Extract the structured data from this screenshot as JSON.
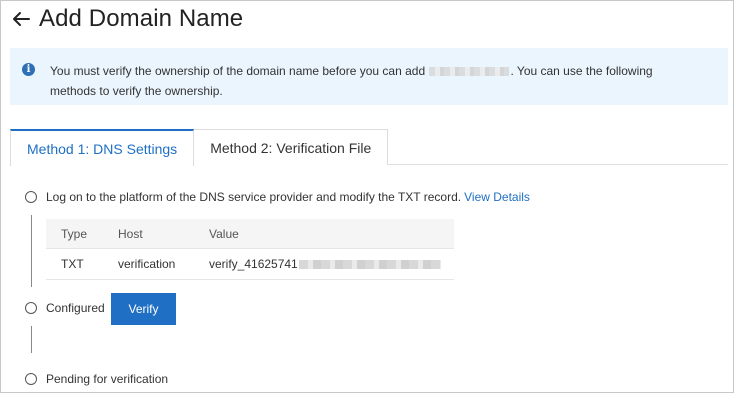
{
  "header": {
    "title": "Add Domain Name"
  },
  "notice": {
    "text_before": "You must verify the ownership of the domain name before you can add",
    "text_after": ". You can use the following",
    "text_line2": "methods to verify the ownership."
  },
  "tabs": [
    {
      "label": "Method 1: DNS Settings"
    },
    {
      "label": "Method 2: Verification File"
    }
  ],
  "steps": {
    "step1_text": "Log on to the platform of the DNS service provider and modify the TXT record.",
    "view_details": "View Details",
    "step2_text": "Configured",
    "verify_label": "Verify",
    "step3_text": "Pending for verification"
  },
  "record_table": {
    "columns": [
      "Type",
      "Host",
      "Value"
    ],
    "rows": [
      {
        "type": "TXT",
        "host": "verification",
        "value": "verify_41625741"
      }
    ]
  },
  "colors": {
    "accent": "#1f6fc5",
    "notice_bg": "#ebf5fd"
  }
}
